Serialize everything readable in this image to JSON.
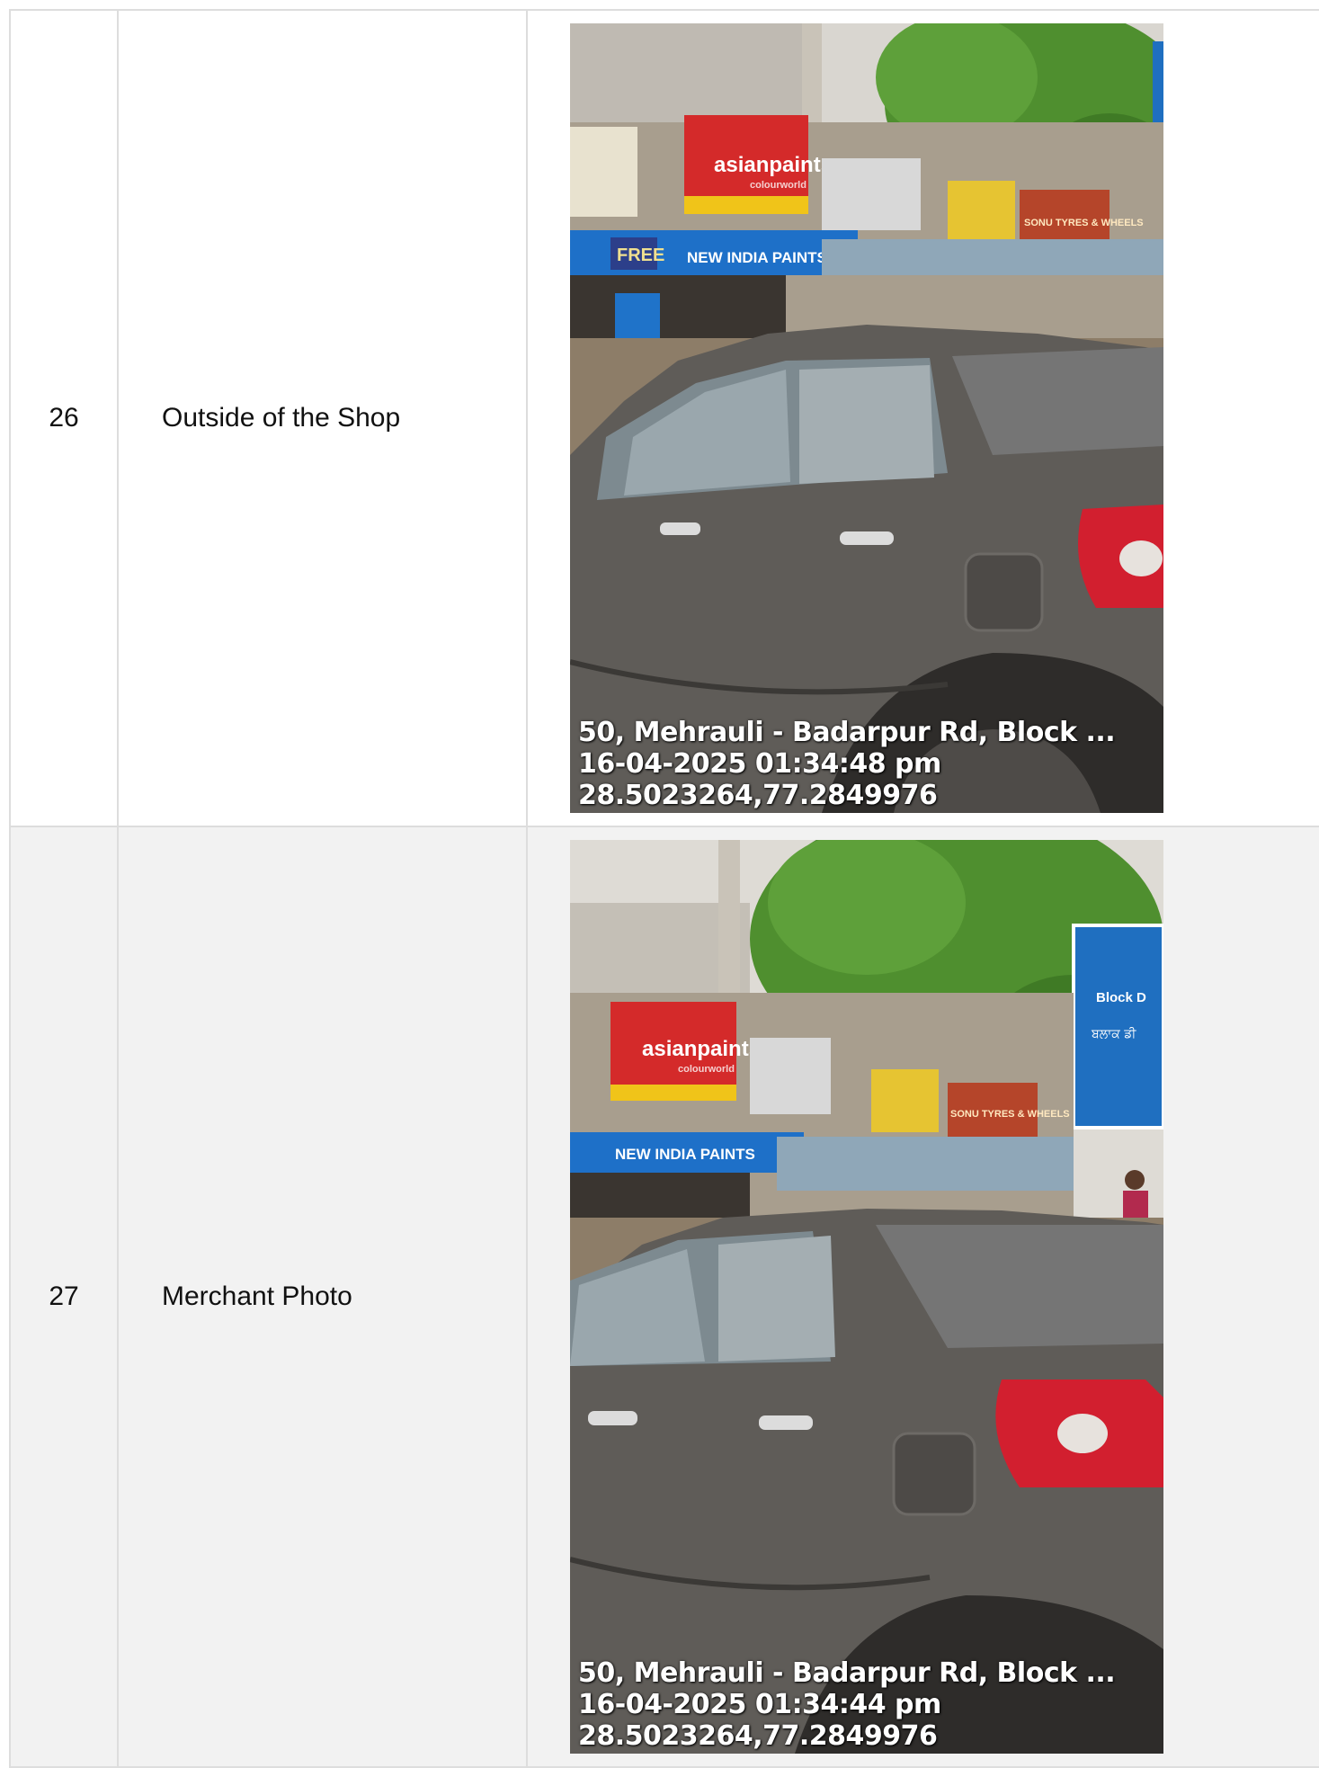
{
  "rows": [
    {
      "number": "26",
      "label": "Outside of the Shop",
      "photo": {
        "description_icon": "storefront-photo",
        "stamp_address": "50, Mehrauli - Badarpur Rd, Block ...",
        "stamp_datetime": "16-04-2025 01:34:48 pm",
        "stamp_coords": "28.5023264,77.2849976",
        "signs": {
          "brand": "asianpaints",
          "brand_sub": "colourworld",
          "shop_banner": "NEW INDIA PAINTS",
          "free_tag": "FREE",
          "tyres_sign": "SONU TYRES & WHEELS"
        }
      }
    },
    {
      "number": "27",
      "label": "Merchant Photo",
      "photo": {
        "description_icon": "merchant-photo",
        "stamp_address": "50, Mehrauli - Badarpur Rd, Block ...",
        "stamp_datetime": "16-04-2025 01:34:44 pm",
        "stamp_coords": "28.5023264,77.2849976",
        "signs": {
          "brand": "asianpaints",
          "brand_sub": "colourworld",
          "shop_banner": "NEW INDIA PAINTS",
          "tyres_sign": "SONU TYRES & WHEELS",
          "road_sign_line1": "Block D",
          "road_sign_line2": "ਬਲਾਕ ਡੀ"
        }
      }
    }
  ]
}
